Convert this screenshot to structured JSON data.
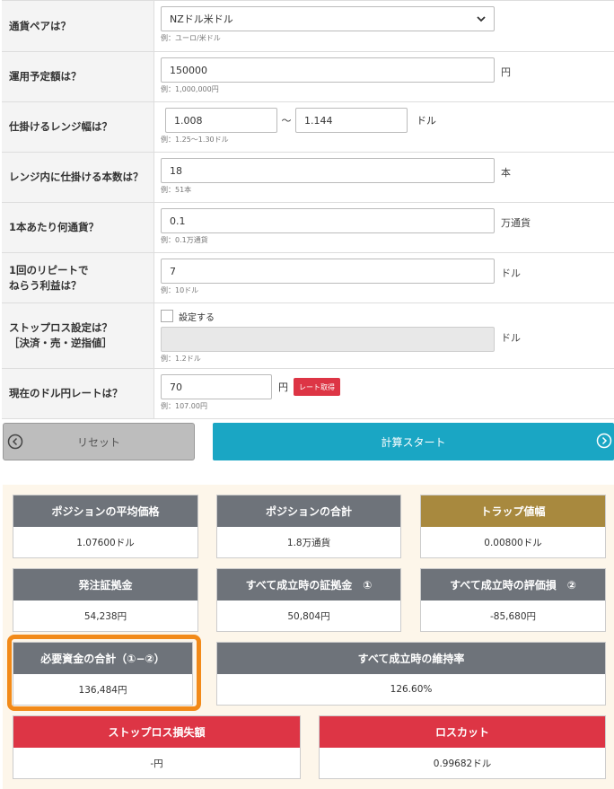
{
  "form": {
    "pair": {
      "label": "通貨ペアは？",
      "value": "NZドル米ドル",
      "example": "例：ユーロ/米ドル"
    },
    "amount": {
      "label": "運用予定額は？",
      "value": "150000",
      "unit": "円",
      "example": "例：1,000,000円"
    },
    "range": {
      "label": "仕掛けるレンジ幅は？",
      "low": "1.008",
      "sep": "〜",
      "high": "1.144",
      "unit": "ドル",
      "example": "例：1.25〜1.30ドル"
    },
    "count": {
      "label": "レンジ内に仕掛ける本数は？",
      "value": "18",
      "unit": "本",
      "example": "例：51本"
    },
    "per_unit": {
      "label": "1本あたり何通貨？",
      "value": "0.1",
      "unit": "万通貨",
      "example": "例：0.1万通貨"
    },
    "profit": {
      "label_line1": "1回のリピートで",
      "label_line2": "ねらう利益は？",
      "value": "7",
      "unit": "ドル",
      "example": "例：10ドル"
    },
    "stoploss": {
      "label_line1": "ストップロス設定は？",
      "label_line2": "［決済・売・逆指値］",
      "checkbox_label": "設定する",
      "value": "",
      "unit": "ドル",
      "example": "例：1.2ドル"
    },
    "rate": {
      "label": "現在のドル円レートは？",
      "value": "70",
      "unit": "円",
      "button": "レート取得",
      "example": "例：107.00円"
    }
  },
  "buttons": {
    "reset": "リセット",
    "start": "計算スタート"
  },
  "results": {
    "avg_price": {
      "title": "ポジションの平均価格",
      "value": "1.07600ドル"
    },
    "total_pos": {
      "title": "ポジションの合計",
      "value": "1.8万通貨"
    },
    "trap_width": {
      "title": "トラップ値幅",
      "value": "0.00800ドル"
    },
    "margin": {
      "title": "発注証拠金",
      "value": "54,238円"
    },
    "full_margin": {
      "title": "すべて成立時の証拠金　①",
      "value": "50,804円"
    },
    "full_loss": {
      "title": "すべて成立時の評価損　②",
      "value": "-85,680円"
    },
    "required": {
      "title": "必要資金の合計（①−②）",
      "value": "136,484円"
    },
    "maint_rate": {
      "title": "すべて成立時の維持率",
      "value": "126.60%"
    },
    "stoploss_amt": {
      "title": "ストップロス損失額",
      "value": "-円"
    },
    "losscut": {
      "title": "ロスカット",
      "value": "0.99682ドル"
    }
  },
  "colors": {
    "header_gray": "#6e737a",
    "header_gold": "#a8893e",
    "header_red": "#dd3545",
    "start_button": "#1aa6c4",
    "highlight": "#f28a19",
    "results_bg": "#fdf6ea"
  }
}
